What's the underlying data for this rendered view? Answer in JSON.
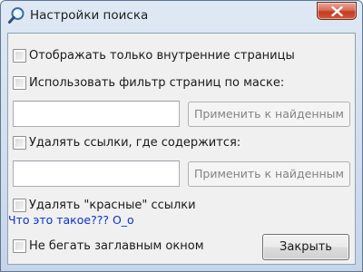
{
  "window": {
    "title": "Настройки поиска",
    "title_icon": "magnifier-icon",
    "close_icon": "close-icon"
  },
  "options": {
    "internal_only_label": "Отображать только внутренние страницы",
    "use_mask_filter_label": "Использовать фильтр страниц по маске:",
    "mask_filter_value": "",
    "apply_mask_label": "Применить к найденным",
    "remove_links_label": "Удалять ссылки, где содержится:",
    "remove_links_value": "",
    "apply_remove_label": "Применить к найденным",
    "remove_red_links_label": "Удалять \"красные\" ссылки",
    "what_is_this_link": "Что это такое??? О_о",
    "no_main_window_label": "Не бегать заглавным окном"
  },
  "buttons": {
    "close_label": "Закрыть"
  },
  "colors": {
    "link": "#0b2fd6",
    "close_button": "#c43c22",
    "window_frame": "#c5d5e8"
  }
}
